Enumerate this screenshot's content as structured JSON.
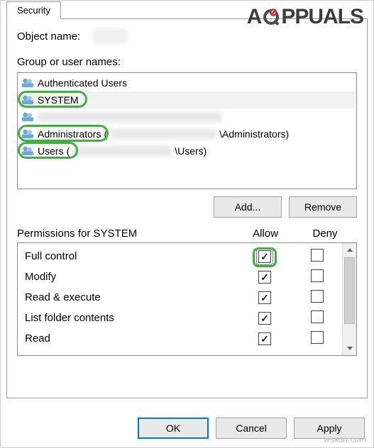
{
  "watermark": {
    "text_left": "A",
    "text_right": "PPUALS"
  },
  "footer_watermark": "wsxdn.com",
  "tab": {
    "security": "Security"
  },
  "object": {
    "label": "Object name:"
  },
  "group_label": "Group or user names:",
  "users_list": {
    "items": [
      {
        "label": "Authenticated Users",
        "redacted_suffix": false,
        "highlight": false
      },
      {
        "label": "SYSTEM",
        "redacted_suffix": false,
        "highlight": true,
        "selected": true
      },
      {
        "label": "",
        "redacted_suffix": true,
        "highlight": false
      },
      {
        "label": "Administrators",
        "redacted_suffix": true,
        "suffix_paren_start": " (",
        "suffix_visible": "\\Administrators)",
        "highlight": true
      },
      {
        "label": "Users",
        "redacted_suffix": true,
        "suffix_paren_start": " (",
        "suffix_visible": "\\Users)",
        "highlight": true
      }
    ]
  },
  "buttons": {
    "add": "Add...",
    "remove": "Remove",
    "ok": "OK",
    "cancel": "Cancel",
    "apply": "Apply"
  },
  "permissions": {
    "header_label": "Permissions for SYSTEM",
    "col_allow": "Allow",
    "col_deny": "Deny",
    "rows": [
      {
        "label": "Full control",
        "allow": true,
        "deny": false,
        "focus": true,
        "highlight": true
      },
      {
        "label": "Modify",
        "allow": true,
        "deny": false
      },
      {
        "label": "Read & execute",
        "allow": true,
        "deny": false
      },
      {
        "label": "List folder contents",
        "allow": true,
        "deny": false
      },
      {
        "label": "Read",
        "allow": true,
        "deny": false
      }
    ]
  }
}
